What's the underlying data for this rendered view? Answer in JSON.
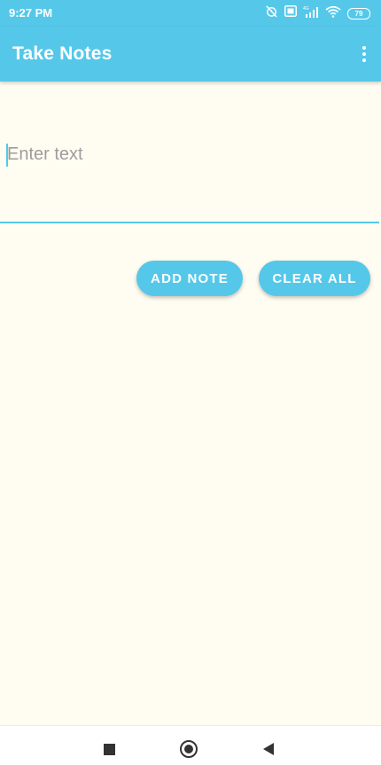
{
  "status_bar": {
    "time": "9:27 PM",
    "icons": [
      "alarm-off-icon",
      "volte-icon",
      "signal-4g-icon",
      "wifi-icon",
      "battery-icon"
    ],
    "battery_level": "79"
  },
  "app_bar": {
    "title": "Take Notes",
    "menu_icon": "more-vert-icon"
  },
  "note_input": {
    "value": "",
    "placeholder": "Enter text"
  },
  "actions": {
    "add_note_label": "ADD NOTE",
    "clear_all_label": "CLEAR ALL"
  },
  "nav_bar": {
    "icons": [
      "recents-square-icon",
      "home-circle-icon",
      "back-triangle-icon"
    ]
  },
  "colors": {
    "accent": "#55c8ea",
    "background": "#fffdf1",
    "placeholder": "#9d9d9d"
  }
}
